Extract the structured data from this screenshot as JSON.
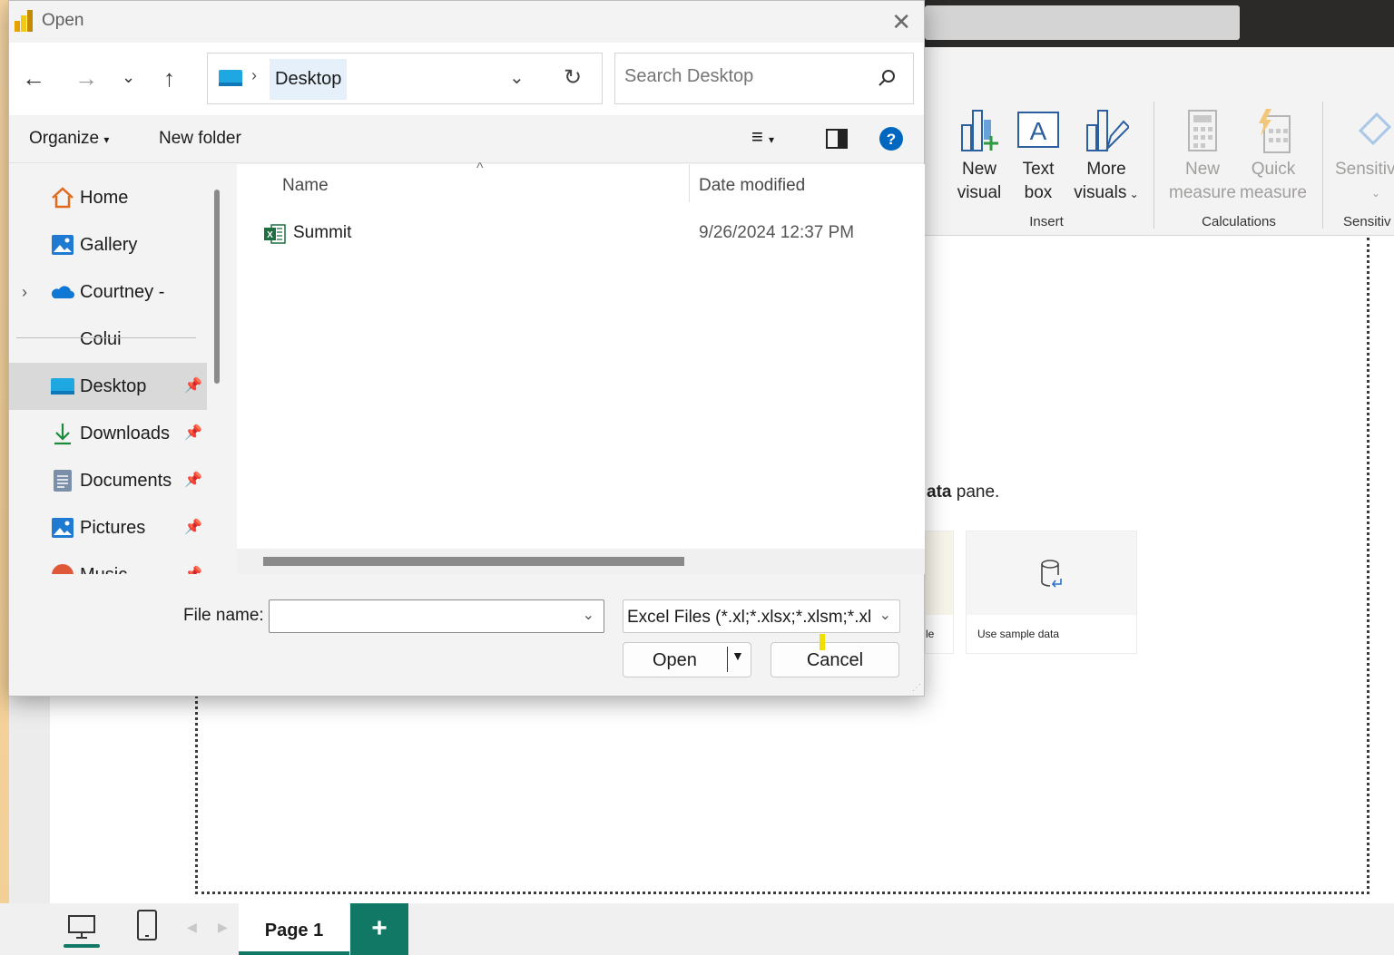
{
  "dialog": {
    "title": "Open",
    "breadcrumb": "Desktop",
    "search_placeholder": "Search Desktop",
    "commands": {
      "organize": "Organize",
      "new_folder": "New folder"
    },
    "nav_items": [
      {
        "label": "Home",
        "icon": "home-icon"
      },
      {
        "label": "Gallery",
        "icon": "gallery-icon"
      },
      {
        "label": "Courtney - Colui",
        "icon": "onedrive-icon"
      },
      {
        "label": "Desktop",
        "icon": "desktop-folder-icon"
      },
      {
        "label": "Downloads",
        "icon": "downloads-icon"
      },
      {
        "label": "Documents",
        "icon": "documents-icon"
      },
      {
        "label": "Pictures",
        "icon": "pictures-icon"
      },
      {
        "label": "Music",
        "icon": "music-icon"
      }
    ],
    "columns": {
      "name": "Name",
      "date": "Date modified"
    },
    "files": [
      {
        "name": "Summit",
        "date": "9/26/2024 12:37 PM",
        "icon": "excel-file-icon"
      }
    ],
    "file_name_label": "File name:",
    "file_name_value": "",
    "file_type": "Excel Files (*.xl;*.xlsx;*.xlsm;*.xlsb",
    "open_button": "Open",
    "cancel_button": "Cancel"
  },
  "ribbon": {
    "buttons": [
      {
        "line1": "New",
        "line2": "visual"
      },
      {
        "line1": "Text",
        "line2": "box"
      },
      {
        "line1": "More",
        "line2": "visuals"
      },
      {
        "line1": "New",
        "line2": "measure"
      },
      {
        "line1": "Quick",
        "line2": "measure"
      },
      {
        "line1": "Sensitiv",
        "line2": ""
      }
    ],
    "groups": {
      "insert": "Insert",
      "calculations": "Calculations",
      "sensitivity": "Sensitiv"
    }
  },
  "canvas": {
    "hint_bold": "ata",
    "hint_rest": " pane.",
    "card_partial": "le",
    "card_sample": "Use sample data"
  },
  "pages": {
    "tab": "Page 1",
    "add": "+"
  },
  "colors": {
    "accent": "#117865",
    "excel_green": "#1d6f42",
    "help_blue": "#0067c0"
  }
}
